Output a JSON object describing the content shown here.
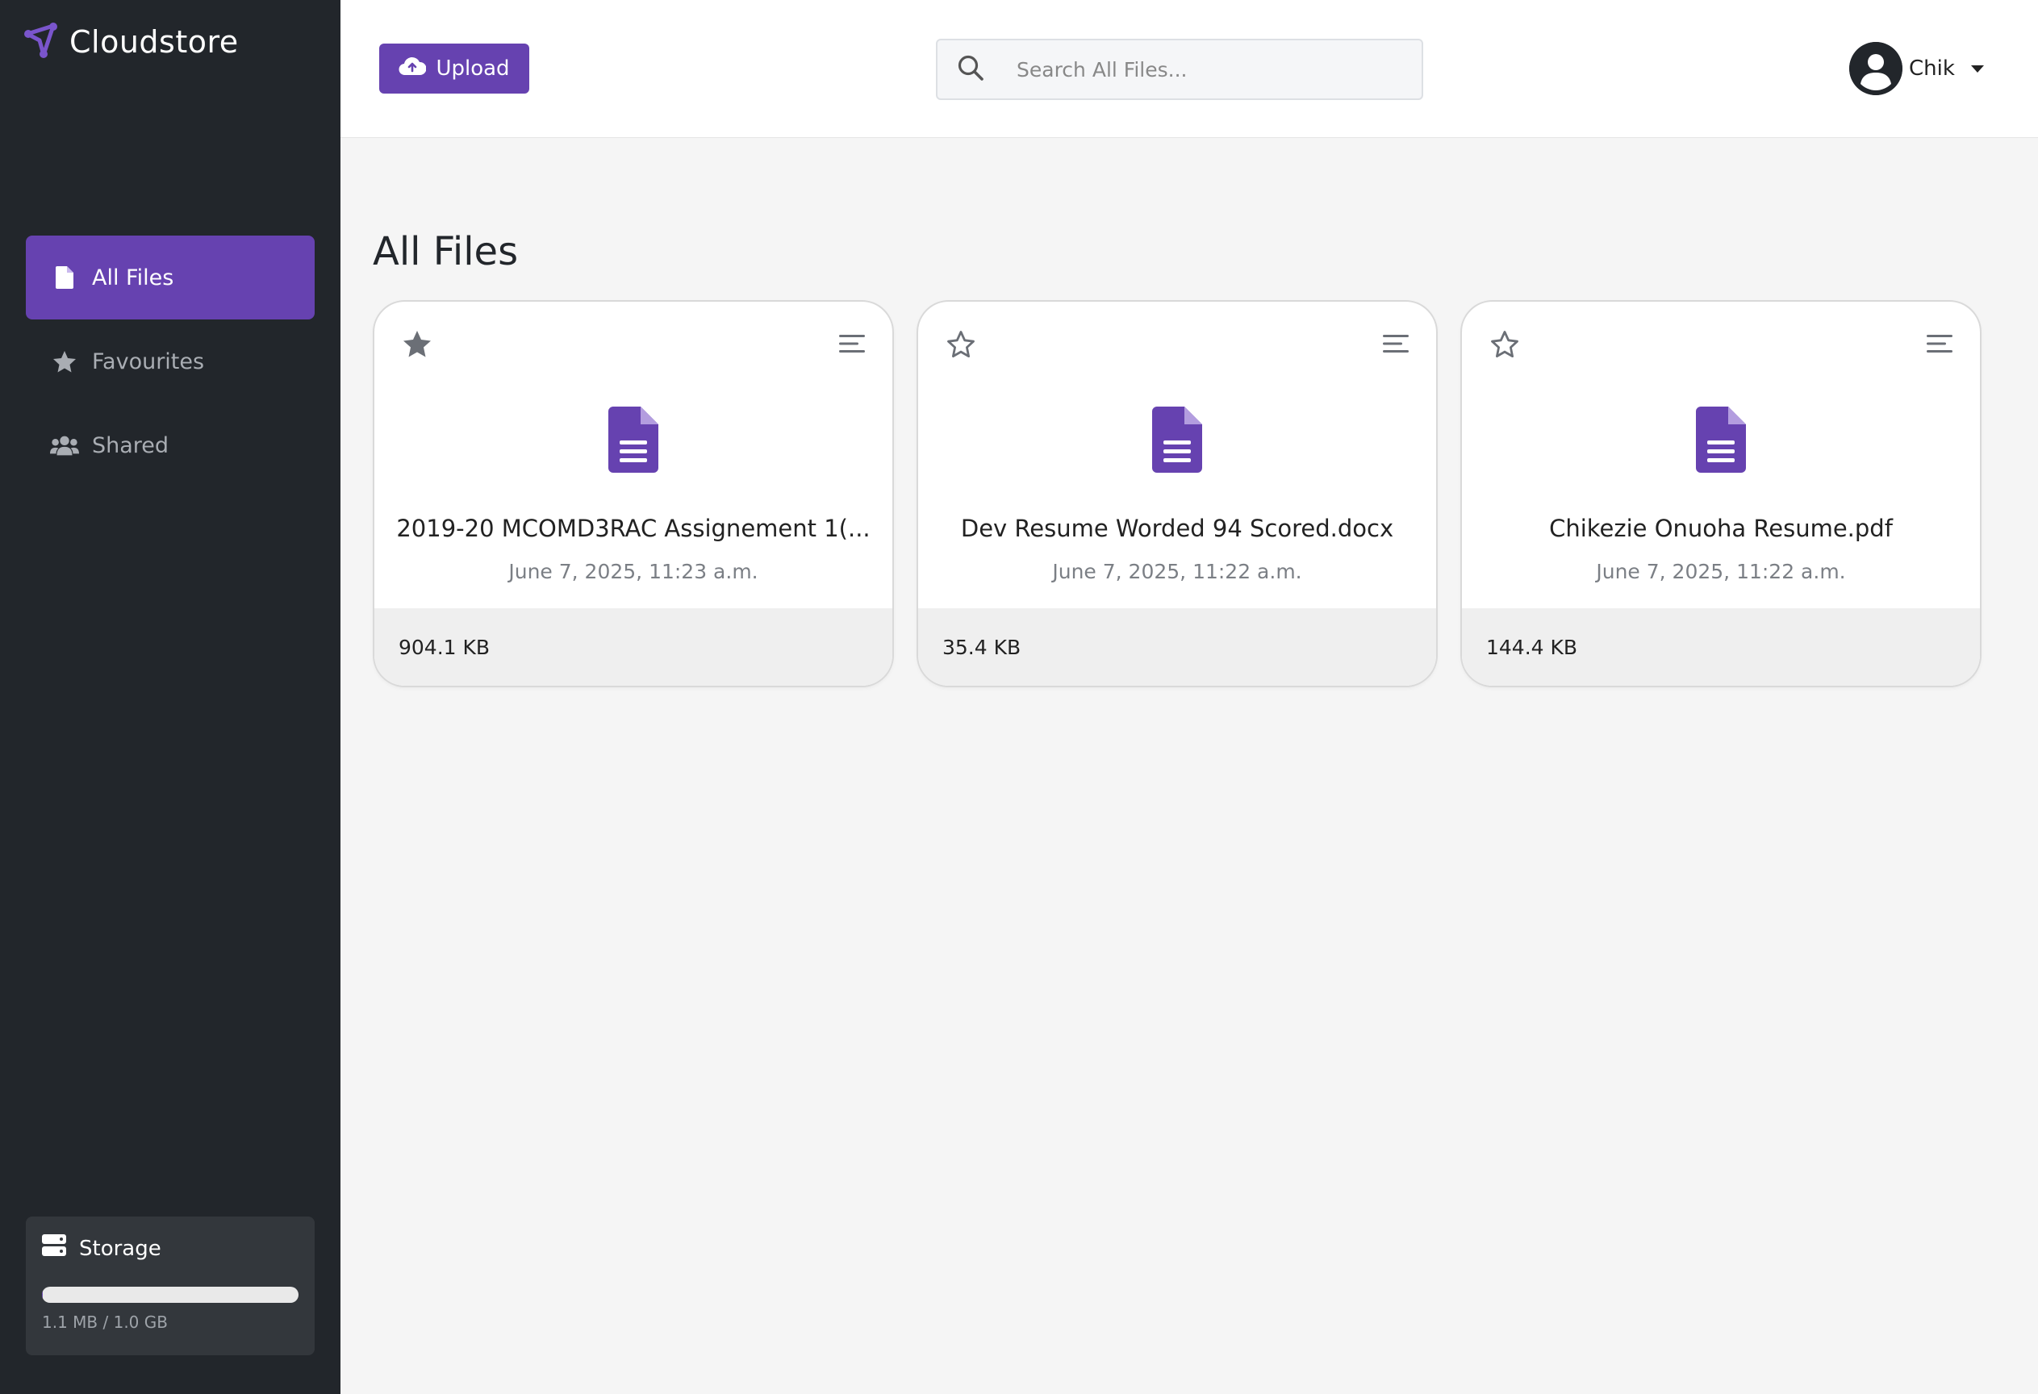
{
  "brand": {
    "name": "Cloudstore",
    "accent_color": "#6642b0"
  },
  "sidebar": {
    "items": [
      {
        "label": "All Files",
        "icon": "file-icon",
        "active": true
      },
      {
        "label": "Favourites",
        "icon": "star-icon",
        "active": false
      },
      {
        "label": "Shared",
        "icon": "users-icon",
        "active": false
      }
    ],
    "storage": {
      "label": "Storage",
      "usage_text": "1.1 MB / 1.0 GB",
      "used_fraction": 0.0011
    }
  },
  "header": {
    "upload_label": "Upload",
    "search_placeholder": "Search All Files...",
    "search_value": "",
    "user_name": "Chik"
  },
  "main": {
    "title": "All Files",
    "files": [
      {
        "name": "2019-20 MCOMD3RAC Assignement 1(...",
        "date": "June 7, 2025, 11:23 a.m.",
        "size": "904.1 KB",
        "favourite": true
      },
      {
        "name": "Dev Resume Worded 94 Scored.docx",
        "date": "June 7, 2025, 11:22 a.m.",
        "size": "35.4 KB",
        "favourite": false
      },
      {
        "name": "Chikezie Onuoha Resume.pdf",
        "date": "June 7, 2025, 11:22 a.m.",
        "size": "144.4 KB",
        "favourite": false
      }
    ]
  }
}
